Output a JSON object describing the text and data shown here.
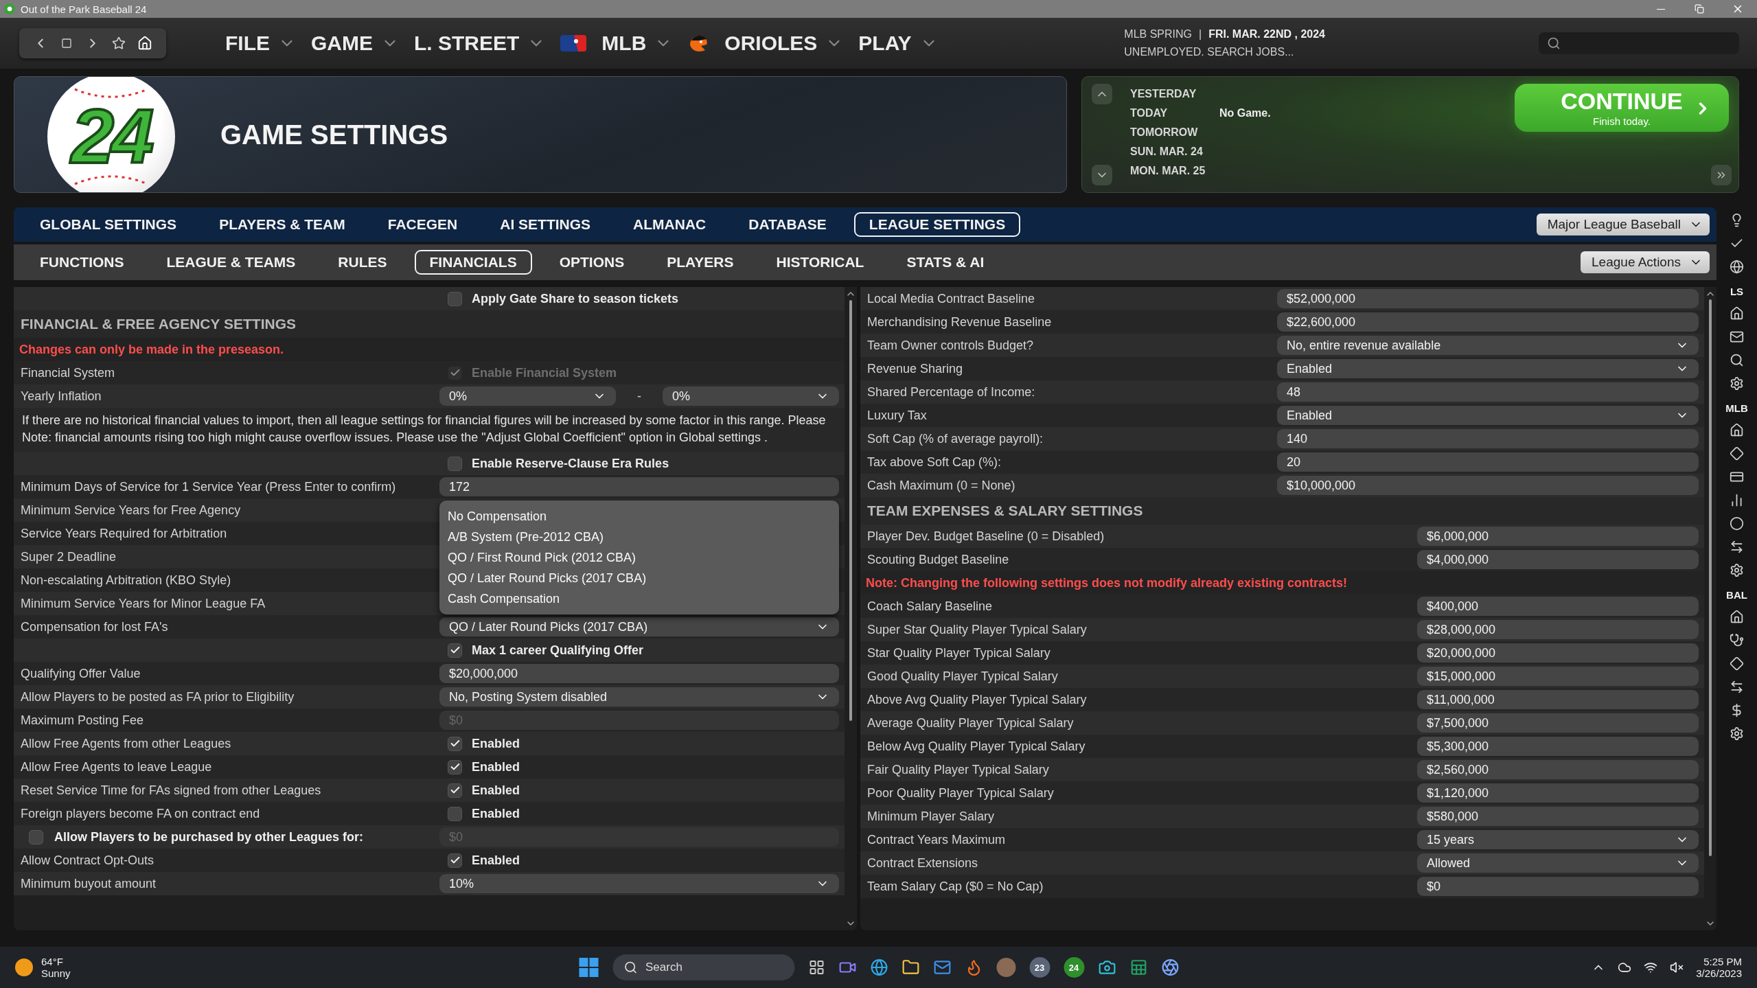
{
  "window": {
    "title": "Out of the Park Baseball 24"
  },
  "nav": {
    "menus": [
      {
        "label": "FILE",
        "kind": "plain"
      },
      {
        "label": "GAME",
        "kind": "plain"
      },
      {
        "label": "L. STREET",
        "kind": "plain"
      },
      {
        "label": "MLB",
        "kind": "league"
      },
      {
        "label": "ORIOLES",
        "kind": "team"
      },
      {
        "label": "PLAY",
        "kind": "plain"
      }
    ],
    "status": {
      "season": "MLB SPRING",
      "separator": "|",
      "date": "FRI. MAR. 22ND , 2024",
      "job": "UNEMPLOYED. SEARCH JOBS..."
    }
  },
  "header": {
    "logo_text": "24",
    "title": "GAME SETTINGS",
    "schedule": [
      {
        "day": "YESTERDAY"
      },
      {
        "day": "TODAY",
        "info": "No Game."
      },
      {
        "day": "TOMORROW"
      },
      {
        "day": "SUN. MAR. 24"
      },
      {
        "day": "MON. MAR. 25"
      }
    ],
    "continue": {
      "label": "CONTINUE",
      "sublabel": "Finish today."
    }
  },
  "tabs": [
    {
      "label": "GLOBAL SETTINGS",
      "selected": false
    },
    {
      "label": "PLAYERS & TEAM",
      "selected": false
    },
    {
      "label": "FACEGEN",
      "selected": false
    },
    {
      "label": "AI SETTINGS",
      "selected": false
    },
    {
      "label": "ALMANAC",
      "selected": false
    },
    {
      "label": "DATABASE",
      "selected": false
    },
    {
      "label": "LEAGUE SETTINGS",
      "selected": true
    }
  ],
  "league_select": "Major League Baseball",
  "subtabs": [
    {
      "label": "FUNCTIONS",
      "selected": false
    },
    {
      "label": "LEAGUE & TEAMS",
      "selected": false
    },
    {
      "label": "RULES",
      "selected": false
    },
    {
      "label": "FINANCIALS",
      "selected": true
    },
    {
      "label": "OPTIONS",
      "selected": false
    },
    {
      "label": "PLAYERS",
      "selected": false
    },
    {
      "label": "HISTORICAL",
      "selected": false
    },
    {
      "label": "STATS & AI",
      "selected": false
    }
  ],
  "actions_select": "League Actions",
  "left_panel": {
    "rows": [
      {
        "kind": "checkbox",
        "text": "Apply Gate Share to season tickets",
        "checked": false,
        "disabled": false
      },
      {
        "kind": "heading",
        "text": "FINANCIAL & FREE AGENCY SETTINGS"
      },
      {
        "kind": "note",
        "text": "Changes can only be made in the preseason."
      },
      {
        "kind": "checkbox",
        "label": "Financial System",
        "text": "Enable Financial System",
        "checked": true,
        "disabled": true
      },
      {
        "kind": "range",
        "label": "Yearly Inflation",
        "from": "0%",
        "separator": "-",
        "to": "0%"
      },
      {
        "kind": "paragraph",
        "text": "If there are no historical financial values to import, then all league settings for financial figures will be increased by some factor in this range. Please Note: financial amounts rising too high might cause overflow issues. Please use the \"Adjust Global Coefficient\" option in Global settings ."
      },
      {
        "kind": "checkbox",
        "text": "Enable Reserve-Clause Era Rules",
        "checked": false,
        "disabled": false
      },
      {
        "kind": "input",
        "label": "Minimum Days of Service for 1 Service Year (Press Enter to confirm)",
        "value": "172",
        "disabled": false
      },
      {
        "kind": "label",
        "label": "Minimum Service Years for Free Agency"
      },
      {
        "kind": "label",
        "label": "Service Years Required for Arbitration"
      },
      {
        "kind": "label",
        "label": "Super 2 Deadline"
      },
      {
        "kind": "label",
        "label": "Non-escalating Arbitration (KBO Style)"
      },
      {
        "kind": "label",
        "label": "Minimum Service Years for Minor League FA"
      },
      {
        "kind": "select",
        "label": "Compensation for lost FA's",
        "value": "QO / Later Round Picks (2017 CBA)",
        "disabled": false,
        "open": true,
        "options": [
          "No Compensation",
          "A/B System (Pre-2012 CBA)",
          "QO / First Round Pick (2012 CBA)",
          "QO / Later Round Picks (2017 CBA)",
          "Cash Compensation"
        ]
      },
      {
        "kind": "checkbox",
        "text": "Max 1 career Qualifying Offer",
        "checked": true,
        "disabled": false
      },
      {
        "kind": "input",
        "label": "Qualifying Offer Value",
        "value": "$20,000,000",
        "disabled": false
      },
      {
        "kind": "select",
        "label": "Allow Players to be posted as FA prior to Eligibility",
        "value": "No, Posting System disabled",
        "disabled": false,
        "open": false
      },
      {
        "kind": "input",
        "label": "Maximum Posting Fee",
        "value": "$0",
        "disabled": true
      },
      {
        "kind": "checkbox",
        "label": "Allow Free Agents from other Leagues",
        "text": "Enabled",
        "checked": true,
        "disabled": false
      },
      {
        "kind": "checkbox",
        "label": "Allow Free Agents to leave League",
        "text": "Enabled",
        "checked": true,
        "disabled": false
      },
      {
        "kind": "checkbox",
        "label": "Reset Service Time for FAs signed from other Leagues",
        "text": "Enabled",
        "checked": true,
        "disabled": false
      },
      {
        "kind": "checkbox",
        "label": "Foreign players become FA on contract end",
        "text": "Enabled",
        "checked": false,
        "disabled": false
      },
      {
        "kind": "checklabel",
        "label": "Allow Players to be purchased by other Leagues for:",
        "checked": false,
        "value": "$0",
        "disabled": true
      },
      {
        "kind": "checkbox",
        "label": "Allow Contract Opt-Outs",
        "text": "Enabled",
        "checked": true,
        "disabled": false
      },
      {
        "kind": "select",
        "label": "Minimum buyout amount",
        "value": "10%",
        "disabled": false,
        "open": false
      }
    ]
  },
  "right_panel": {
    "sections": [
      {
        "rows": [
          {
            "kind": "input",
            "label": "Local Media Contract Baseline",
            "value": "$52,000,000"
          },
          {
            "kind": "input",
            "label": "Merchandising Revenue Baseline",
            "value": "$22,600,000"
          },
          {
            "kind": "select",
            "label": "Team Owner controls Budget?",
            "value": "No, entire revenue available"
          },
          {
            "kind": "select",
            "label": "Revenue Sharing",
            "value": "Enabled"
          },
          {
            "kind": "input",
            "label": "Shared Percentage of Income:",
            "value": "48"
          },
          {
            "kind": "select",
            "label": "Luxury Tax",
            "value": "Enabled"
          },
          {
            "kind": "input",
            "label": "Soft Cap (% of average payroll):",
            "value": "140"
          },
          {
            "kind": "input",
            "label": "Tax above Soft Cap (%):",
            "value": "20"
          },
          {
            "kind": "input",
            "label": "Cash Maximum (0 = None)",
            "value": "$10,000,000"
          }
        ]
      },
      {
        "heading": "TEAM EXPENSES & SALARY SETTINGS",
        "rows": [
          {
            "kind": "input",
            "label": "Player Dev. Budget Baseline (0 = Disabled)",
            "value": "$6,000,000"
          },
          {
            "kind": "input",
            "label": "Scouting Budget Baseline",
            "value": "$4,000,000"
          },
          {
            "kind": "note",
            "text": "Note: Changing the following settings does not modify already existing contracts!"
          },
          {
            "kind": "input",
            "label": "Coach Salary Baseline",
            "value": "$400,000"
          },
          {
            "kind": "input",
            "label": "Super Star Quality Player Typical Salary",
            "value": "$28,000,000"
          },
          {
            "kind": "input",
            "label": "Star Quality Player Typical Salary",
            "value": "$20,000,000"
          },
          {
            "kind": "input",
            "label": "Good Quality Player Typical Salary",
            "value": "$15,000,000"
          },
          {
            "kind": "input",
            "label": "Above Avg Quality Player Typical Salary",
            "value": "$11,000,000"
          },
          {
            "kind": "input",
            "label": "Average Quality Player Typical Salary",
            "value": "$7,500,000"
          },
          {
            "kind": "input",
            "label": "Below Avg Quality Player Typical Salary",
            "value": "$5,300,000"
          },
          {
            "kind": "input",
            "label": "Fair Quality Player Typical Salary",
            "value": "$2,560,000"
          },
          {
            "kind": "input",
            "label": "Poor Quality Player Typical Salary",
            "value": "$1,120,000"
          },
          {
            "kind": "input",
            "label": "Minimum Player Salary",
            "value": "$580,000"
          },
          {
            "kind": "select",
            "label": "Contract Years Maximum",
            "value": "15 years"
          },
          {
            "kind": "select",
            "label": "Contract Extensions",
            "value": "Allowed"
          },
          {
            "kind": "input",
            "label": "Team Salary Cap ($0 = No Cap)",
            "value": "$0"
          }
        ]
      }
    ]
  },
  "sidebar": {
    "groups": [
      {
        "label": "LS"
      },
      {
        "label": "MLB"
      },
      {
        "label": "BAL"
      }
    ]
  },
  "taskbar": {
    "weather": {
      "temp": "64°F",
      "condition": "Sunny"
    },
    "search_label": "Search",
    "app_badges": [
      "23",
      "24"
    ],
    "time": "5:25 PM",
    "date": "3/26/2023"
  }
}
